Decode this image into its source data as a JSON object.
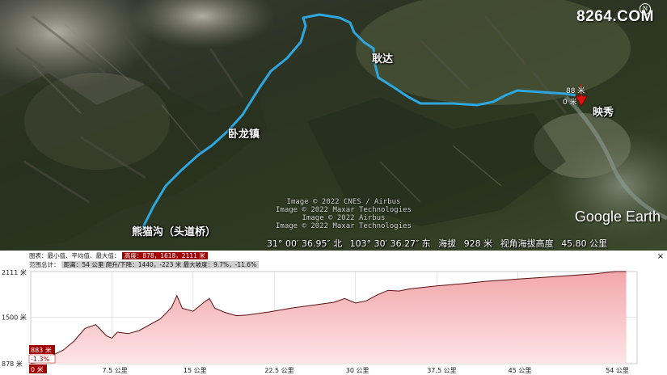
{
  "watermark": "8264.COM",
  "compass": "N",
  "map": {
    "places": [
      {
        "name": "熊猫沟（头道桥）",
        "id": "place-xiongmaogou"
      },
      {
        "name": "卧龙镇",
        "id": "place-wolong"
      },
      {
        "name": "耿达",
        "id": "place-gengda"
      },
      {
        "name": "映秀",
        "id": "place-yingxiu"
      }
    ],
    "marker": {
      "elevation_label": "88 米",
      "distance_label": "0 米"
    },
    "credits": [
      "Image © 2022 CNES / Airbus",
      "Image © 2022 Maxar Technologies",
      "Image © 2022 Airbus",
      "Image © 2022 Maxar Technologies"
    ],
    "brand": "Google Earth",
    "colors": {
      "route": "#2ea6e0",
      "marker": "#e01010"
    }
  },
  "status": {
    "lat": "31° 00′ 36.95″ 北",
    "lon": "103° 30′ 36.27″ 东",
    "elev_label": "海拔",
    "elev": "928 米",
    "eye_label": "视角海拔高度",
    "eye": "45.80 公里"
  },
  "profile_panel": {
    "close": "×",
    "row1_label": "图表：最小值、平均值、最大值：",
    "row1_value": "高度：878，1618，2111 米",
    "row2_label": "范围总计：",
    "row2_value": "距离：54 公里 爬升/下降：1440，-223 米 最大坡度：9.7%，-11.6%",
    "cursor_elev": "883 米",
    "cursor_grade": "-1.3%",
    "cursor_dist": "0 米"
  },
  "chart_data": {
    "type": "area",
    "title": "",
    "xlabel": "",
    "ylabel": "",
    "x_unit": "公里",
    "y_unit": "米",
    "xlim": [
      0,
      56
    ],
    "ylim": [
      878,
      2111
    ],
    "y_ticks": [
      2111,
      1500,
      878
    ],
    "y_tick_labels": [
      "2111 米",
      "1500 米",
      "878 米"
    ],
    "x_ticks": [
      7.5,
      15,
      22.5,
      30,
      37.5,
      45,
      54
    ],
    "x_tick_labels": [
      "7.5 公里",
      "15 公里",
      "22.5 公里",
      "30 公里",
      "37.5 公里",
      "45 公里",
      "54 公里"
    ],
    "series": [
      {
        "x": [
          0,
          1,
          2,
          3,
          4,
          5,
          6,
          7,
          7.5,
          8,
          9,
          10,
          11,
          12,
          13,
          13.5,
          14,
          15,
          16,
          16.5,
          17,
          18,
          19,
          20,
          22,
          24,
          26,
          28,
          29,
          30,
          31,
          32,
          33,
          34,
          35,
          37.5,
          40,
          42,
          45,
          48,
          50,
          52,
          54,
          55
        ],
        "y": [
          883,
          900,
          990,
          1060,
          1180,
          1350,
          1400,
          1250,
          1220,
          1300,
          1280,
          1320,
          1400,
          1480,
          1630,
          1790,
          1620,
          1580,
          1700,
          1750,
          1620,
          1560,
          1520,
          1530,
          1570,
          1620,
          1660,
          1700,
          1750,
          1690,
          1720,
          1800,
          1860,
          1850,
          1880,
          1920,
          1950,
          1980,
          2010,
          2040,
          2060,
          2080,
          2111,
          2111
        ]
      }
    ]
  }
}
